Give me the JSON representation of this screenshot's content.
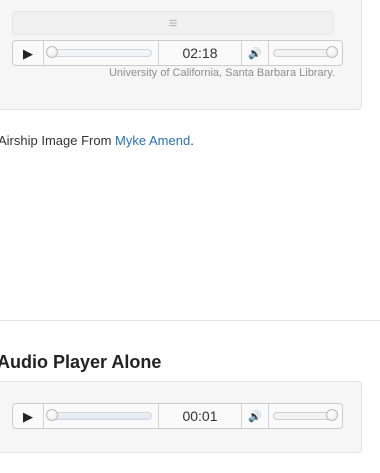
{
  "top_player": {
    "drag_handle_glyph": "≡",
    "play_glyph": "▶",
    "time": "02:18",
    "volume_glyph": "🔊",
    "progress": 0.0,
    "volume": 1.0
  },
  "credit_text": "University of California, Santa Barbara Library.",
  "airship": {
    "prefix": "Airship Image From ",
    "link_text": "Myke Amend",
    "suffix": "."
  },
  "section": {
    "title": "Audio Player Alone"
  },
  "bottom_player": {
    "play_glyph": "▶",
    "time": "00:01",
    "volume_glyph": "🔊",
    "progress": 0.0,
    "volume": 1.0
  },
  "colors": {
    "link": "#2a72b8",
    "panel_bg": "#f6f6f6",
    "credit": "#8f8f8f"
  }
}
